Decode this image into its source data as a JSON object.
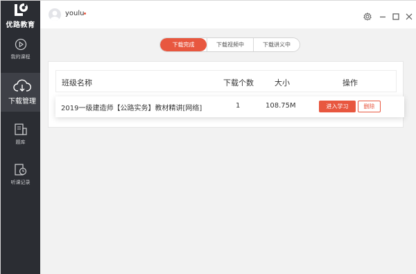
{
  "brand": {
    "name": "优路教育"
  },
  "sidebar": {
    "items": [
      {
        "label": "我的课程",
        "icon": "play-circle-icon"
      },
      {
        "label": "下载管理",
        "icon": "cloud-download-icon",
        "active": true
      },
      {
        "label": "题库",
        "icon": "question-bank-icon"
      },
      {
        "label": "听课记录",
        "icon": "history-clock-icon"
      }
    ]
  },
  "header": {
    "username": "youlu",
    "icons": [
      "gear-icon",
      "minimize-icon",
      "maximize-icon",
      "close-icon"
    ]
  },
  "tabs": [
    {
      "label": "下载完成",
      "active": true
    },
    {
      "label": "下载视频中",
      "active": false
    },
    {
      "label": "下载讲义中",
      "active": false
    }
  ],
  "table": {
    "headers": {
      "name": "班级名称",
      "count": "下载个数",
      "size": "大小",
      "op": "操作"
    },
    "rows": [
      {
        "name": "2019一级建造师【公路实务】教材精讲[网络]",
        "count": "1",
        "size": "108.75M",
        "study_label": "进入学习",
        "delete_label": "删除"
      }
    ]
  },
  "colors": {
    "accent": "#e8573f",
    "sidebar_bg": "#2b2d33",
    "content_bg": "#f2f2f2"
  }
}
